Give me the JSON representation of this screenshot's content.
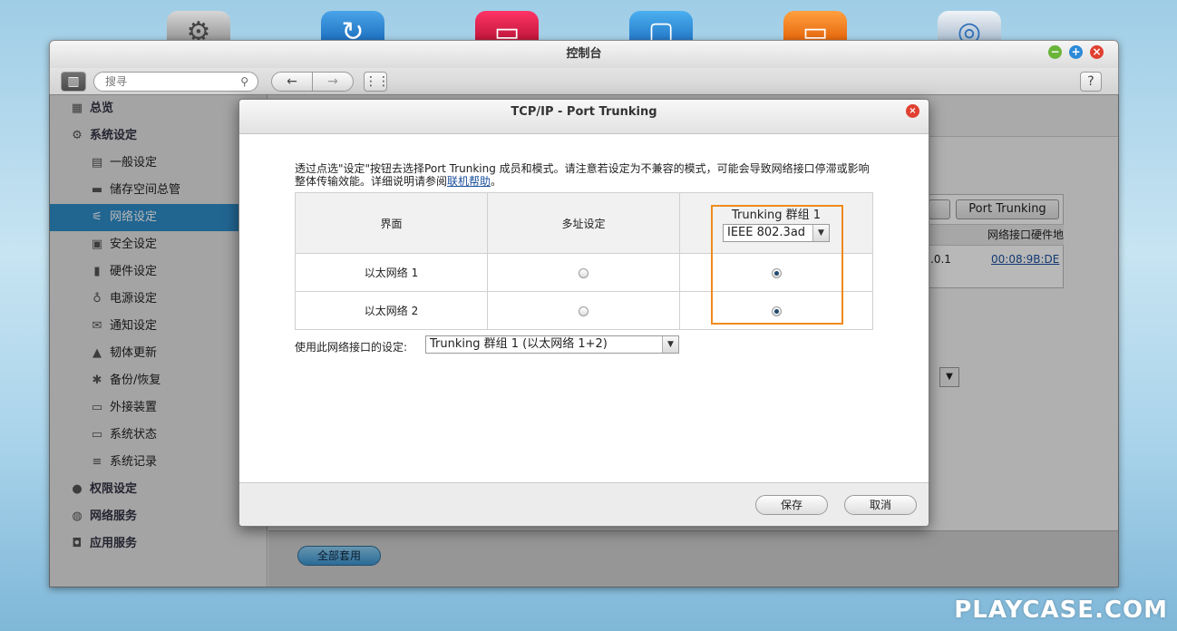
{
  "window": {
    "title": "控制台",
    "search_placeholder": "搜寻",
    "help_label": "?"
  },
  "sidebar": {
    "items": [
      {
        "label": "总览",
        "level": "top",
        "icon": "overview-icon"
      },
      {
        "label": "系统设定",
        "level": "top",
        "icon": "gear-icon"
      },
      {
        "label": "一般设定",
        "level": "sub",
        "icon": "general-settings-icon"
      },
      {
        "label": "储存空间总管",
        "level": "sub",
        "icon": "storage-icon"
      },
      {
        "label": "网络设定",
        "level": "sub",
        "icon": "network-icon",
        "active": true
      },
      {
        "label": "安全设定",
        "level": "sub",
        "icon": "lock-icon"
      },
      {
        "label": "硬件设定",
        "level": "sub",
        "icon": "hardware-icon"
      },
      {
        "label": "电源设定",
        "level": "sub",
        "icon": "power-icon"
      },
      {
        "label": "通知设定",
        "level": "sub",
        "icon": "notification-icon"
      },
      {
        "label": "韧体更新",
        "level": "sub",
        "icon": "firmware-icon"
      },
      {
        "label": "备份/恢复",
        "level": "sub",
        "icon": "backup-restore-icon"
      },
      {
        "label": "外接装置",
        "level": "sub",
        "icon": "external-device-icon"
      },
      {
        "label": "系统状态",
        "level": "sub",
        "icon": "monitor-icon"
      },
      {
        "label": "系统记录",
        "level": "sub",
        "icon": "log-icon"
      },
      {
        "label": "权限设定",
        "level": "top",
        "icon": "user-icon"
      },
      {
        "label": "网络服务",
        "level": "top",
        "icon": "network-service-icon"
      },
      {
        "label": "应用服务",
        "level": "top",
        "icon": "app-service-icon"
      }
    ]
  },
  "background": {
    "port_trunking_label": "Port Trunking",
    "mac_header": "网络接口硬件地",
    "ip_fragment": ".0.1",
    "mac_value": "00:08:9B:DE",
    "apply_all_label": "全部套用"
  },
  "dialog": {
    "title": "TCP/IP - Port Trunking",
    "description": "透过点选\"设定\"按钮去选择Port Trunking 成员和模式。请注意若设定为不兼容的模式，可能会导致网络接口停滞或影响整体传输效能。详细说明请参阅",
    "help_link": "联机帮助",
    "description_end": "。",
    "table": {
      "headers": [
        "界面",
        "多址设定",
        "Trunking 群组 1"
      ],
      "mode_value": "IEEE 802.3ad",
      "rows": [
        {
          "interface": "以太网络 1",
          "multi_address": false,
          "trunk_group_1": true
        },
        {
          "interface": "以太网络 2",
          "multi_address": false,
          "trunk_group_1": true
        }
      ]
    },
    "use_label": "使用此网络接口的设定:",
    "use_value": "Trunking 群组 1 (以太网络 1+2)",
    "save_label": "保存",
    "cancel_label": "取消"
  },
  "watermark": "PLAYCASE.COM",
  "colors": {
    "accent": "#2f8cc9",
    "highlight": "#f08a1c",
    "close": "#e04030"
  }
}
